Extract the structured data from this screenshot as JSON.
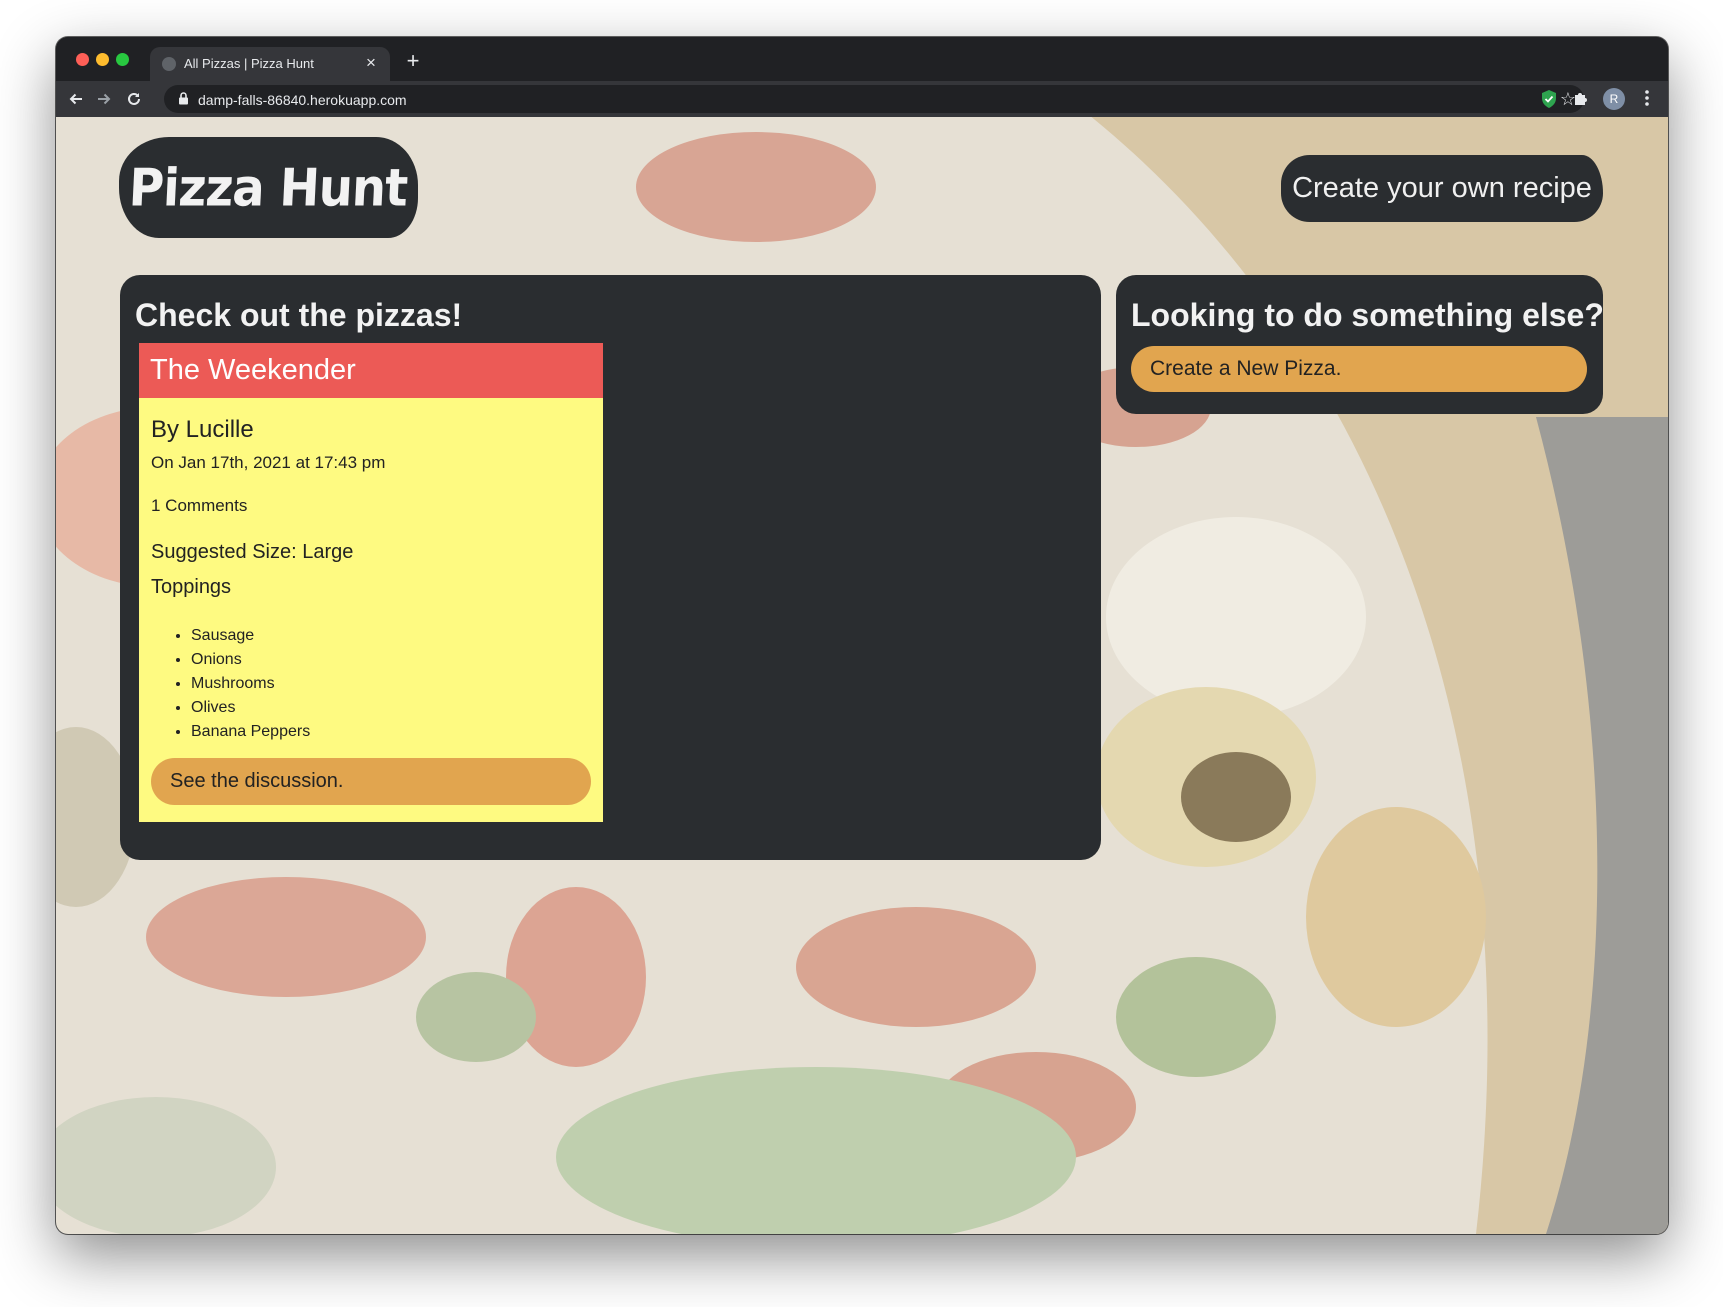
{
  "browser": {
    "tab_title": "All Pizzas | Pizza Hunt",
    "tab_close": "×",
    "new_tab": "+",
    "url": "damp-falls-86840.herokuapp.com",
    "avatar_letter": "R"
  },
  "header": {
    "logo": "Pizza Hunt",
    "create_recipe_link": "Create your own recipe"
  },
  "main": {
    "heading": "Check out the pizzas!",
    "pizzas": [
      {
        "name": "The Weekender",
        "author": "By Lucille",
        "date": "On Jan 17th, 2021 at 17:43 pm",
        "comments": "1 Comments",
        "size": "Suggested Size: Large",
        "toppings_label": "Toppings",
        "toppings": [
          "Sausage",
          "Onions",
          "Mushrooms",
          "Olives",
          "Banana Peppers"
        ],
        "discussion_button": "See the discussion."
      }
    ]
  },
  "sidebar": {
    "heading": "Looking to do something else?",
    "new_pizza_button": "Create a New Pizza."
  },
  "colors": {
    "panel": "#2a2d30",
    "card_header": "#ec5a56",
    "card_body": "#fefa81",
    "button": "#e1a54f"
  }
}
